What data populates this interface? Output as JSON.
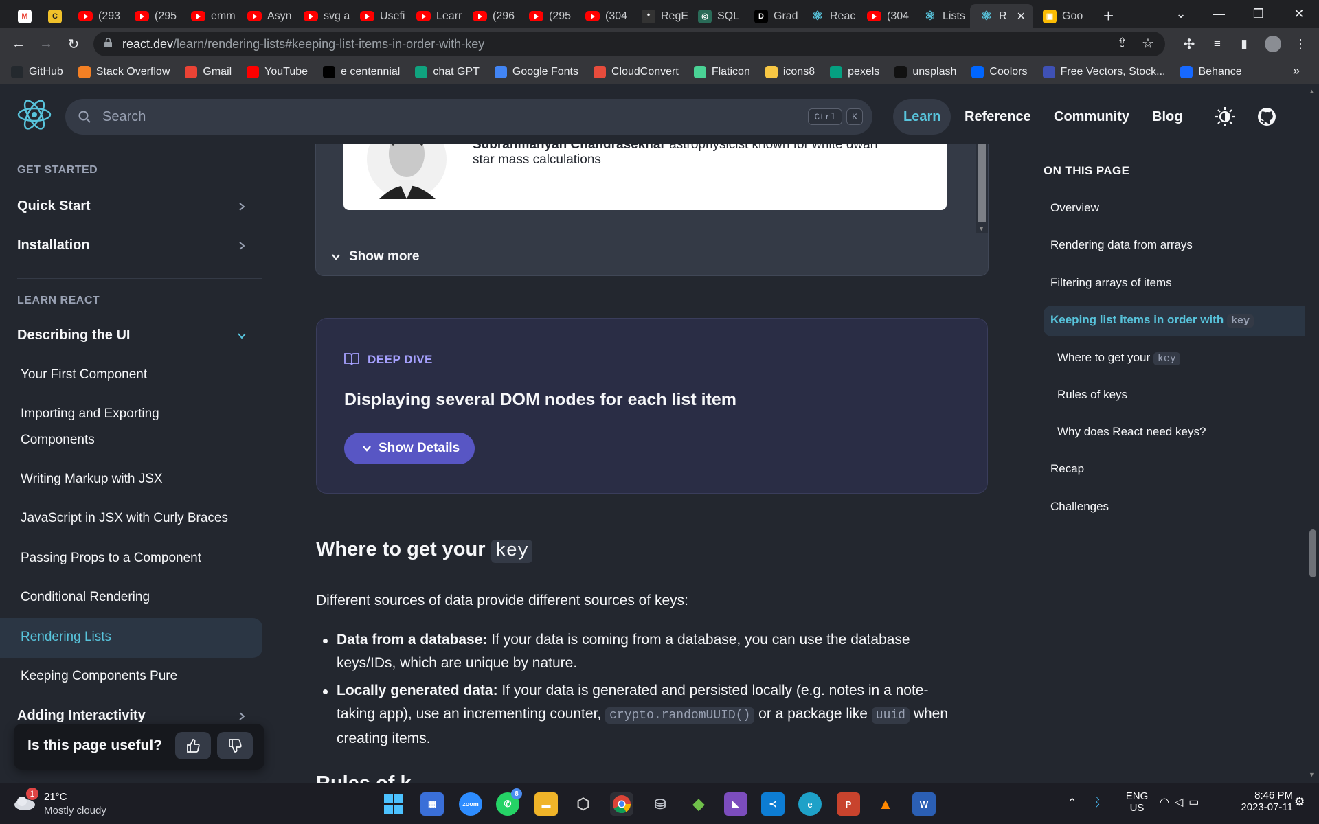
{
  "browser": {
    "tabs": [
      {
        "icon": "gmail-icon",
        "label": ""
      },
      {
        "icon": "c-icon",
        "label": ""
      },
      {
        "icon": "youtube-icon",
        "label": "(293"
      },
      {
        "icon": "youtube-icon",
        "label": "(295"
      },
      {
        "icon": "youtube-icon",
        "label": "emm"
      },
      {
        "icon": "youtube-icon",
        "label": "Asyn"
      },
      {
        "icon": "youtube-icon",
        "label": "svg a"
      },
      {
        "icon": "youtube-icon",
        "label": "Usefi"
      },
      {
        "icon": "youtube-icon",
        "label": "Learr"
      },
      {
        "icon": "youtube-icon",
        "label": "(296"
      },
      {
        "icon": "youtube-icon",
        "label": "(295"
      },
      {
        "icon": "youtube-icon",
        "label": "(304"
      },
      {
        "icon": "regex-icon",
        "label": "RegE"
      },
      {
        "icon": "sql-icon",
        "label": "SQL"
      },
      {
        "icon": "d2l-icon",
        "label": "Grad"
      },
      {
        "icon": "react-icon",
        "label": "Reac"
      },
      {
        "icon": "youtube-icon",
        "label": "(304"
      },
      {
        "icon": "react-icon",
        "label": "Lists"
      },
      {
        "icon": "react-icon",
        "label": "R"
      },
      {
        "icon": "keep-icon",
        "label": "Goo"
      }
    ],
    "new_tab": "+",
    "url_host": "react.dev",
    "url_path": "/learn/rendering-lists#keeping-list-items-in-order-with-key",
    "bookmarks": [
      {
        "label": "GitHub",
        "color": "#24292e"
      },
      {
        "label": "Stack Overflow",
        "color": "#f48024"
      },
      {
        "label": "Gmail",
        "color": "#ea4335"
      },
      {
        "label": "YouTube",
        "color": "#ff0000"
      },
      {
        "label": "e centennial",
        "color": "#000000"
      },
      {
        "label": "chat GPT",
        "color": "#10a37f"
      },
      {
        "label": "Google Fonts",
        "color": "#4285f4"
      },
      {
        "label": "CloudConvert",
        "color": "#e74c3c"
      },
      {
        "label": "Flaticon",
        "color": "#4ad295"
      },
      {
        "label": "icons8",
        "color": "#f7c744"
      },
      {
        "label": "pexels",
        "color": "#05a081"
      },
      {
        "label": "unsplash",
        "color": "#111111"
      },
      {
        "label": "Coolors",
        "color": "#0066ff"
      },
      {
        "label": "Free Vectors, Stock...",
        "color": "#3f51b5"
      },
      {
        "label": "Behance",
        "color": "#1769ff"
      }
    ],
    "bookmark_overflow": "»"
  },
  "site": {
    "search_placeholder": "Search",
    "kbd_ctrl": "Ctrl",
    "kbd_k": "K",
    "nav": [
      "Learn",
      "Reference",
      "Community",
      "Blog"
    ],
    "accent": "#58c4dc"
  },
  "sidebar": {
    "get_started": "GET STARTED",
    "quick_start": "Quick Start",
    "installation": "Installation",
    "learn_react": "LEARN REACT",
    "describing_ui": "Describing the UI",
    "items": [
      "Your First Component",
      "Importing and Exporting",
      "Components",
      "Writing Markup with JSX",
      "JavaScript in JSX with Curly Braces",
      "Passing Props to a Component",
      "Conditional Rendering",
      "Rendering Lists",
      "Keeping Components Pure"
    ],
    "adding_interactivity": "Adding Interactivity"
  },
  "feedback": {
    "question": "Is this page useful?"
  },
  "main": {
    "preview_name": "Subrahmanyan Chandrasekhar",
    "preview_desc_1": "astrophysicist known for white dwarf",
    "preview_desc_2": "star mass calculations",
    "show_more": "Show more",
    "deep_dive_label": "DEEP DIVE",
    "deep_dive_title": "Displaying several DOM nodes for each list item",
    "show_details": "Show Details",
    "h2_prefix": "Where to get your",
    "h2_code": "key",
    "intro": "Different sources of data provide different sources of keys:",
    "bullet1_bold": "Data from a database:",
    "bullet1_line1": " If your data is coming from a database, you can use the database",
    "bullet1_line2": "keys/IDs, which are unique by nature.",
    "bullet2_bold": "Locally generated data:",
    "bullet2_line1": " If your data is generated and persisted locally (e.g. notes in a note-",
    "bullet2_line2a": "taking app), use an incrementing counter,",
    "bullet2_code1": "crypto.randomUUID()",
    "bullet2_line2b": " or a package like ",
    "bullet2_code2": "uuid",
    "bullet2_line2c": " when",
    "bullet2_line3": "creating items.",
    "next_heading_partial": "Rules of k"
  },
  "toc": {
    "title": "ON THIS PAGE",
    "items": [
      {
        "label": "Overview"
      },
      {
        "label": "Rendering data from arrays"
      },
      {
        "label": "Filtering arrays of items"
      },
      {
        "label": "Keeping list items in order with",
        "code": "key",
        "active": true
      },
      {
        "label": "Where to get your",
        "code": "key",
        "sub": true
      },
      {
        "label": "Rules of keys",
        "sub": true
      },
      {
        "label": "Why does React need keys?",
        "sub": true
      },
      {
        "label": "Recap"
      },
      {
        "label": "Challenges"
      }
    ]
  },
  "taskbar": {
    "weather_temp": "21°C",
    "weather_desc": "Mostly cloudy",
    "weather_badge": "1",
    "whatsapp_badge": "8",
    "lang_1": "ENG",
    "lang_2": "US",
    "time": "8:46 PM",
    "date": "2023-07-11"
  }
}
